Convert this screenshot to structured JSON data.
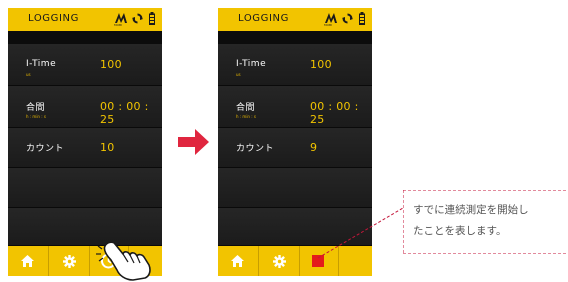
{
  "colors": {
    "accent": "#f2c400",
    "screen_bg": "#141414",
    "stop_red": "#e41b1b",
    "annotation": "#c4163a"
  },
  "screens": [
    {
      "title": "LOGGING",
      "logo_caption": "MOBI",
      "rows": [
        {
          "label": "I-Time",
          "unit": "us",
          "value": "100"
        },
        {
          "label": "合間",
          "unit": "h : min : s",
          "value": "00 : 00 : 25"
        },
        {
          "label": "カウント",
          "unit": "",
          "value": "10"
        }
      ],
      "bottom_buttons": [
        "home-icon",
        "gear-icon",
        "timer-icon"
      ]
    },
    {
      "title": "LOGGING",
      "logo_caption": "MOBI",
      "rows": [
        {
          "label": "I-Time",
          "unit": "us",
          "value": "100"
        },
        {
          "label": "合間",
          "unit": "h : min : s",
          "value": "00 : 00 : 25"
        },
        {
          "label": "カウント",
          "unit": "",
          "value": "9"
        }
      ],
      "bottom_buttons": [
        "home-icon",
        "gear-icon",
        "stop-icon"
      ]
    }
  ],
  "callout": {
    "line1": "すでに連続測定を開始し",
    "line2": "たことを表します。"
  }
}
